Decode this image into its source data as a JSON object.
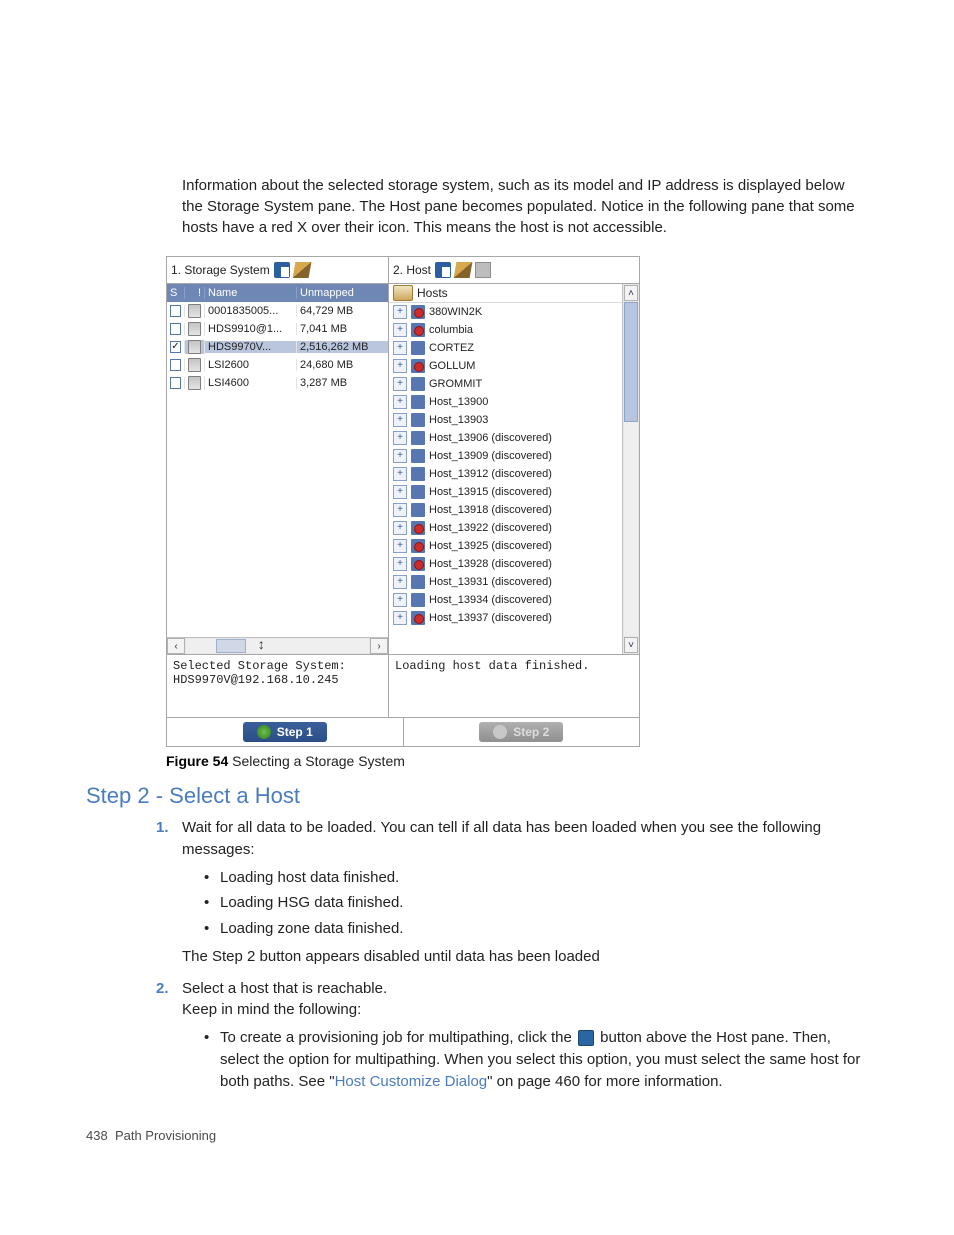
{
  "intro": "Information about the selected storage system, such as its model and IP address  is displayed below the Storage System pane. The Host pane becomes populated. Notice in the following pane that some hosts have a red X over their icon. This means the host is not accessible.",
  "screenshot": {
    "pane1_title": "1. Storage System",
    "pane2_title": "2. Host",
    "grid_headers": {
      "s": "S",
      "flag": "!",
      "name": "Name",
      "unmapped": "Unmapped"
    },
    "storage_rows": [
      {
        "checked": false,
        "name": "0001835005...",
        "unmapped": "64,729 MB"
      },
      {
        "checked": false,
        "name": "HDS9910@1...",
        "unmapped": "7,041 MB"
      },
      {
        "checked": true,
        "name": "HDS9970V...",
        "unmapped": "2,516,262 MB",
        "sel": true
      },
      {
        "checked": false,
        "name": "LSI2600",
        "unmapped": "24,680 MB"
      },
      {
        "checked": false,
        "name": "LSI4600",
        "unmapped": "3,287 MB"
      }
    ],
    "hosts_root_label": "Hosts",
    "host_items": [
      {
        "name": "380WIN2K",
        "bad": true
      },
      {
        "name": "columbia",
        "bad": true
      },
      {
        "name": "CORTEZ",
        "bad": false
      },
      {
        "name": "GOLLUM",
        "bad": true
      },
      {
        "name": "GROMMIT",
        "bad": false
      },
      {
        "name": "Host_13900",
        "bad": false
      },
      {
        "name": "Host_13903",
        "bad": false
      },
      {
        "name": "Host_13906 (discovered)",
        "bad": false
      },
      {
        "name": "Host_13909 (discovered)",
        "bad": false
      },
      {
        "name": "Host_13912 (discovered)",
        "bad": false
      },
      {
        "name": "Host_13915 (discovered)",
        "bad": false
      },
      {
        "name": "Host_13918 (discovered)",
        "bad": false
      },
      {
        "name": "Host_13922 (discovered)",
        "bad": true
      },
      {
        "name": "Host_13925 (discovered)",
        "bad": true
      },
      {
        "name": "Host_13928 (discovered)",
        "bad": true
      },
      {
        "name": "Host_13931 (discovered)",
        "bad": false
      },
      {
        "name": "Host_13934 (discovered)",
        "bad": false
      },
      {
        "name": "Host_13937 (discovered)",
        "bad": true
      }
    ],
    "selected_label": "Selected Storage System:",
    "selected_value": "HDS9970V@192.168.10.245",
    "host_status": "Loading host data finished.",
    "step1": "Step 1",
    "step2": "Step 2"
  },
  "caption": {
    "label": "Figure 54 ",
    "text": "Selecting a Storage System"
  },
  "section_title": "Step 2 - Select a Host",
  "step_items": {
    "s1_lead": "Wait for all data to be loaded. You can tell if all data has been loaded when you see the following messages:",
    "b1": "Loading host data finished.",
    "b2": "Loading HSG data finished.",
    "b3": "Loading zone data finished.",
    "s1_tail": "The Step 2 button appears disabled until data has been loaded",
    "s2_lead": "Select a host that is reachable.",
    "s2_keep": "Keep in mind the following:",
    "s2_bullet_a": "To create a provisioning job for multipathing, click the ",
    "s2_bullet_b": " button above the Host pane. Then, select the option for multipathing. When you select this option, you must select the same host for both paths. See \"",
    "s2_link": "Host Customize Dialog",
    "s2_bullet_c": "\" on page 460 for more information."
  },
  "footer": {
    "page": "438",
    "title": "Path Provisioning"
  }
}
